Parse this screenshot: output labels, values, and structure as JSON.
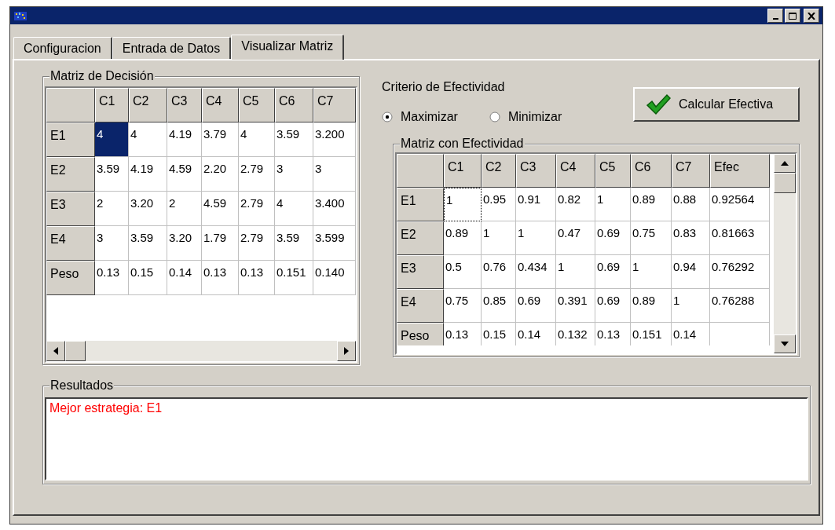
{
  "tabs": [
    {
      "label": "Configuracion",
      "selected": false
    },
    {
      "label": "Entrada de Datos",
      "selected": false
    },
    {
      "label": "Visualizar Matriz",
      "selected": true
    }
  ],
  "decision_matrix": {
    "title": "Matriz de Decisión",
    "columns": [
      "C1",
      "C2",
      "C3",
      "C4",
      "C5",
      "C6",
      "C7"
    ],
    "rows": [
      {
        "label": "E1",
        "cells": [
          {
            "text": "4",
            "selected": true
          },
          {
            "text": "4",
            "selected": false
          },
          {
            "text": "4.19",
            "selected": false
          },
          {
            "text": "3.79",
            "selected": false
          },
          {
            "text": "4",
            "selected": false
          },
          {
            "text": "3.59",
            "selected": false
          },
          {
            "text": "3.200",
            "selected": false
          }
        ]
      },
      {
        "label": "E2",
        "cells": [
          {
            "text": "3.59",
            "selected": false
          },
          {
            "text": "4.19",
            "selected": false
          },
          {
            "text": "4.59",
            "selected": false
          },
          {
            "text": "2.20",
            "selected": false
          },
          {
            "text": "2.79",
            "selected": false
          },
          {
            "text": "3",
            "selected": false
          },
          {
            "text": "3",
            "selected": false
          }
        ]
      },
      {
        "label": "E3",
        "cells": [
          {
            "text": "2",
            "selected": false
          },
          {
            "text": "3.20",
            "selected": false
          },
          {
            "text": "2",
            "selected": false
          },
          {
            "text": "4.59",
            "selected": false
          },
          {
            "text": "2.79",
            "selected": false
          },
          {
            "text": "4",
            "selected": false
          },
          {
            "text": "3.400",
            "selected": false
          }
        ]
      },
      {
        "label": "E4",
        "cells": [
          {
            "text": "3",
            "selected": false
          },
          {
            "text": "3.59",
            "selected": false
          },
          {
            "text": "3.20",
            "selected": false
          },
          {
            "text": "1.79",
            "selected": false
          },
          {
            "text": "2.79",
            "selected": false
          },
          {
            "text": "3.59",
            "selected": false
          },
          {
            "text": "3.599",
            "selected": false
          }
        ]
      },
      {
        "label": "Peso",
        "cells": [
          {
            "text": "0.13",
            "selected": false
          },
          {
            "text": "0.15",
            "selected": false
          },
          {
            "text": "0.14",
            "selected": false
          },
          {
            "text": "0.13",
            "selected": false
          },
          {
            "text": "0.13",
            "selected": false
          },
          {
            "text": "0.151",
            "selected": false
          },
          {
            "text": "0.140",
            "selected": false
          }
        ]
      }
    ]
  },
  "criterion": {
    "label": "Criterio de Efectividad",
    "options": [
      {
        "label": "Maximizar",
        "selected": true
      },
      {
        "label": "Minimizar",
        "selected": false
      }
    ],
    "button": "Calcular Efectiva"
  },
  "effectiveness_matrix": {
    "title": "Matriz con Efectividad",
    "columns": [
      "C1",
      "C2",
      "C3",
      "C4",
      "C5",
      "C6",
      "C7",
      "Efec"
    ],
    "rows": [
      {
        "label": "E1",
        "cells": [
          {
            "text": "1",
            "selected": true
          },
          {
            "text": "0.95",
            "selected": false
          },
          {
            "text": "0.91",
            "selected": false
          },
          {
            "text": "0.82",
            "selected": false
          },
          {
            "text": "1",
            "selected": false
          },
          {
            "text": "0.89",
            "selected": false
          },
          {
            "text": "0.88",
            "selected": false
          },
          {
            "text": "0.92564",
            "selected": false
          }
        ]
      },
      {
        "label": "E2",
        "cells": [
          {
            "text": "0.89",
            "selected": false
          },
          {
            "text": "1",
            "selected": false
          },
          {
            "text": "1",
            "selected": false
          },
          {
            "text": "0.47",
            "selected": false
          },
          {
            "text": "0.69",
            "selected": false
          },
          {
            "text": "0.75",
            "selected": false
          },
          {
            "text": "0.83",
            "selected": false
          },
          {
            "text": "0.81663",
            "selected": false
          }
        ]
      },
      {
        "label": "E3",
        "cells": [
          {
            "text": "0.5",
            "selected": false
          },
          {
            "text": "0.76",
            "selected": false
          },
          {
            "text": "0.434",
            "selected": false
          },
          {
            "text": "1",
            "selected": false
          },
          {
            "text": "0.69",
            "selected": false
          },
          {
            "text": "1",
            "selected": false
          },
          {
            "text": "0.94",
            "selected": false
          },
          {
            "text": "0.76292",
            "selected": false
          }
        ]
      },
      {
        "label": "E4",
        "cells": [
          {
            "text": "0.75",
            "selected": false
          },
          {
            "text": "0.85",
            "selected": false
          },
          {
            "text": "0.69",
            "selected": false
          },
          {
            "text": "0.391",
            "selected": false
          },
          {
            "text": "0.69",
            "selected": false
          },
          {
            "text": "0.89",
            "selected": false
          },
          {
            "text": "1",
            "selected": false
          },
          {
            "text": "0.76288",
            "selected": false
          }
        ]
      },
      {
        "label": "Peso",
        "cells": [
          {
            "text": "0.13",
            "selected": false
          },
          {
            "text": "0.15",
            "selected": false
          },
          {
            "text": "0.14",
            "selected": false
          },
          {
            "text": "0.132",
            "selected": false
          },
          {
            "text": "0.13",
            "selected": false
          },
          {
            "text": "0.151",
            "selected": false
          },
          {
            "text": "0.14",
            "selected": false
          }
        ]
      }
    ]
  },
  "results": {
    "title": "Resultados",
    "lines": [
      "Mejor estrategia: E1"
    ]
  }
}
